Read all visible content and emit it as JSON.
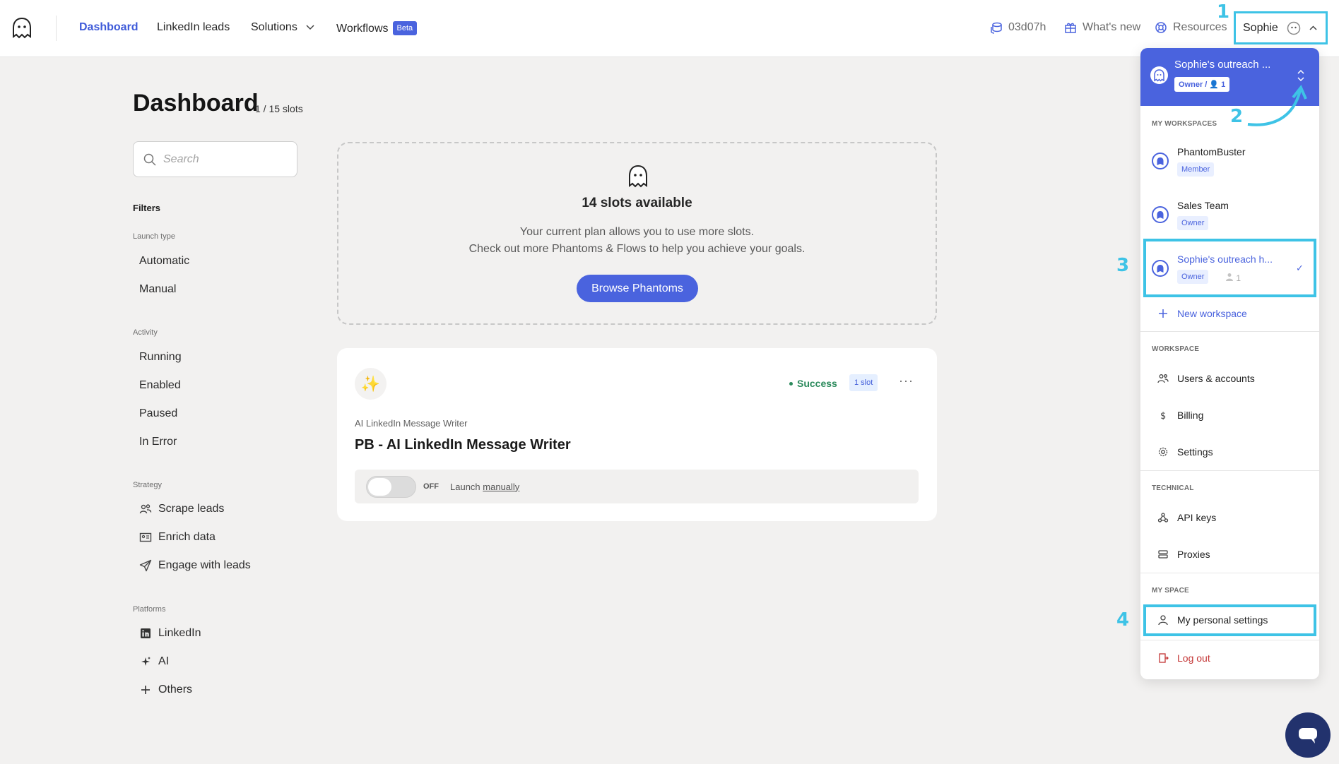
{
  "nav": {
    "items": [
      {
        "label": "Dashboard"
      },
      {
        "label": "LinkedIn leads"
      },
      {
        "label": "Solutions"
      },
      {
        "label": "Workflows",
        "badge": "Beta"
      }
    ],
    "time_remaining": "03d07h",
    "whats_new": "What's new",
    "resources": "Resources",
    "user": "Sophie"
  },
  "page": {
    "title": "Dashboard",
    "slots_count": "1 / 15 slots"
  },
  "search": {
    "placeholder": "Search"
  },
  "filters": {
    "title": "Filters",
    "groups": [
      {
        "title": "Launch type",
        "items": [
          "Automatic",
          "Manual"
        ]
      },
      {
        "title": "Activity",
        "items": [
          "Running",
          "Enabled",
          "Paused",
          "In Error"
        ]
      },
      {
        "title": "Strategy",
        "items": [
          "Scrape leads",
          "Enrich data",
          "Engage with leads"
        ]
      },
      {
        "title": "Platforms",
        "items": [
          "LinkedIn",
          "AI",
          "Others"
        ]
      }
    ]
  },
  "slots_card": {
    "title": "14 slots available",
    "line1": "Your current plan allows you to use more slots.",
    "line2": "Check out more Phantoms & Flows to help you achieve your goals.",
    "button": "Browse Phantoms"
  },
  "phantom": {
    "status": "Success",
    "slot_badge": "1 slot",
    "more": "···",
    "type": "AI LinkedIn Message Writer",
    "name": "PB - AI LinkedIn Message Writer",
    "toggle_state": "OFF",
    "launch_prefix": "Launch",
    "launch_mode": "manually"
  },
  "dropdown": {
    "current_workspace": "Sophie's outreach ...",
    "current_badge": "Owner / 👤 1",
    "sections": {
      "my_workspaces": "MY WORKSPACES",
      "workspace": "WORKSPACE",
      "technical": "TECHNICAL",
      "my_space": "MY SPACE"
    },
    "workspaces": [
      {
        "name": "PhantomBuster",
        "role": "Member"
      },
      {
        "name": "Sales Team",
        "role": "Owner"
      },
      {
        "name": "Sophie's outreach h...",
        "role": "Owner",
        "members": "1"
      }
    ],
    "new_workspace": "New workspace",
    "workspace_links": [
      "Users & accounts",
      "Billing",
      "Settings"
    ],
    "technical_links": [
      "API keys",
      "Proxies"
    ],
    "my_space_links": [
      "My personal settings"
    ],
    "logout": "Log out"
  },
  "callouts": [
    "1",
    "2",
    "3",
    "4"
  ],
  "colors": {
    "accent": "#4a63de",
    "highlight": "#3ec3e6",
    "success": "#2b8a5c",
    "logout": "#c43636"
  }
}
